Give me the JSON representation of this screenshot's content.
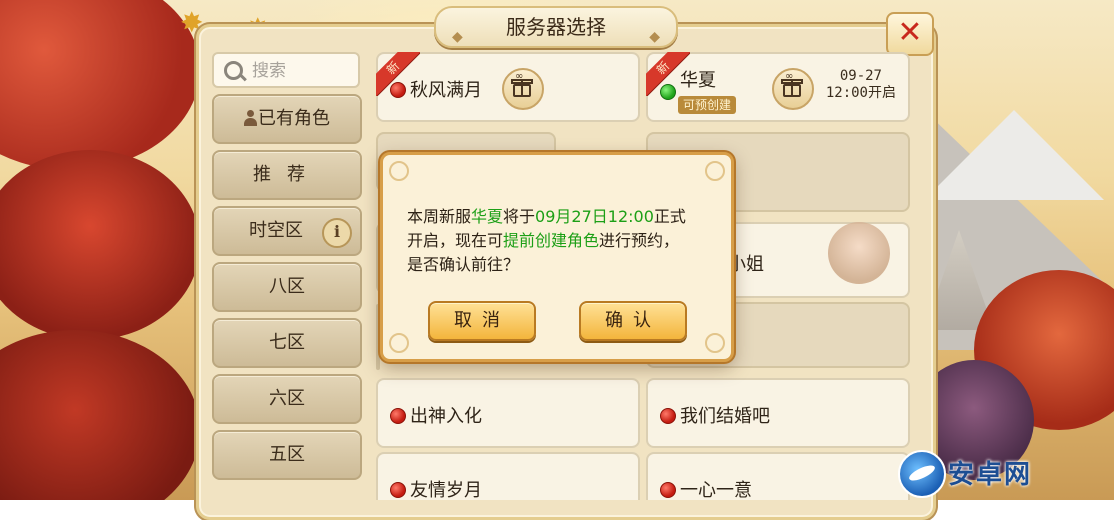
{
  "window": {
    "title": "服务器选择"
  },
  "search": {
    "placeholder": "搜索"
  },
  "sidebar": {
    "items": [
      {
        "label": "已有角色"
      },
      {
        "label": "推荐"
      },
      {
        "label": "时空区"
      },
      {
        "label": "八区"
      },
      {
        "label": "七区"
      },
      {
        "label": "六区"
      },
      {
        "label": "五区"
      }
    ]
  },
  "servers": [
    {
      "name": "秋风满月",
      "ribbon": "新",
      "status": "red"
    },
    {
      "name": "华夏",
      "ribbon": "新",
      "status": "green",
      "tag": "可预创建",
      "open_date": "09-27",
      "open_time": "12:00开启"
    },
    {
      "name": "小姐",
      "status": "red"
    },
    {
      "name": "出神入化",
      "status": "red"
    },
    {
      "name": "我们结婚吧",
      "status": "red"
    },
    {
      "name": "友情岁月",
      "status": "red"
    },
    {
      "name": "一心一意",
      "status": "red"
    }
  ],
  "dialog": {
    "line1_a": "本周新服",
    "line1_server": "华夏",
    "line1_b": "将于",
    "line1_datetime": "09月27日12:00",
    "line1_c": "正式",
    "line2_a": "开启，现在可",
    "line2_action": "提前创建角色",
    "line2_b": "进行预约，",
    "line3": "是否确认前往？",
    "cancel_label": "取消",
    "confirm_label": "确认"
  },
  "watermark": {
    "text": "安卓网"
  },
  "colors": {
    "accent_green": "#1c9f16",
    "accent_red": "#c3271b",
    "button_gold": "#f3b53c"
  }
}
